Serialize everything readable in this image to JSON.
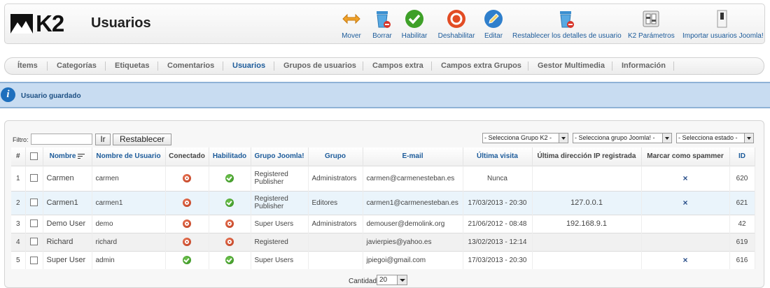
{
  "app": {
    "logo_text": "K2",
    "page_title": "Usuarios"
  },
  "toolbar": {
    "buttons": [
      {
        "label": "Mover",
        "icon": "move-arrows-icon"
      },
      {
        "label": "Borrar",
        "icon": "trash-icon"
      },
      {
        "label": "Habilitar",
        "icon": "check-circle-icon"
      },
      {
        "label": "Deshabilitar",
        "icon": "stop-circle-icon"
      },
      {
        "label": "Editar",
        "icon": "pencil-icon"
      },
      {
        "label": "Restablecer los detalles de usuario",
        "icon": "trash-reset-icon"
      },
      {
        "label": "K2 Parámetros",
        "icon": "settings-panel-icon"
      },
      {
        "label": "Importar usuarios Joomla!",
        "icon": "import-icon"
      }
    ]
  },
  "submenu": {
    "tabs": [
      {
        "label": "Ítems"
      },
      {
        "label": "Categorías"
      },
      {
        "label": "Etiquetas"
      },
      {
        "label": "Comentarios"
      },
      {
        "label": "Usuarios",
        "active": true
      },
      {
        "label": "Grupos de usuarios"
      },
      {
        "label": "Campos extra"
      },
      {
        "label": "Campos extra Grupos"
      },
      {
        "label": "Gestor Multimedia"
      },
      {
        "label": "Información"
      }
    ]
  },
  "message": {
    "text": "Usuario guardado",
    "icon": "info-icon"
  },
  "filter": {
    "label": "Filtro:",
    "value": "",
    "go_label": "Ir",
    "reset_label": "Restablecer",
    "selects": [
      {
        "value": "- Selecciona Grupo K2 -"
      },
      {
        "value": "- Selecciona grupo Joomla! -"
      },
      {
        "value": "- Selecciona estado -"
      }
    ]
  },
  "table": {
    "headers": {
      "num": "#",
      "nombre": "Nombre",
      "usuario": "Nombre de Usuario",
      "conectado": "Conectado",
      "habilitado": "Habilitado",
      "grupo_joomla": "Grupo Joomla!",
      "grupo": "Grupo",
      "email": "E-mail",
      "ultima_visita": "Última visita",
      "ip": "Última dirección IP registrada",
      "spammer": "Marcar como spammer",
      "id": "ID"
    },
    "rows": [
      {
        "num": "1",
        "nombre": "Carmen",
        "usuario": "carmen",
        "conectado": "off",
        "habilitado": "on",
        "grupo_joomla": "Registered Publisher",
        "grupo": "Administrators",
        "email": "carmen@carmenesteban.es",
        "ultima_visita": "Nunca",
        "ip": "",
        "spammer": "×",
        "id": "620"
      },
      {
        "num": "2",
        "nombre": "Carmen1",
        "usuario": "carmen1",
        "conectado": "off",
        "habilitado": "on",
        "grupo_joomla": "Registered Publisher",
        "grupo": "Editores",
        "email": "carmen1@carmenesteban.es",
        "ultima_visita": "17/03/2013 - 20:30",
        "ip": "127.0.0.1",
        "spammer": "×",
        "id": "621"
      },
      {
        "num": "3",
        "nombre": "Demo User",
        "usuario": "demo",
        "conectado": "off",
        "habilitado": "off",
        "grupo_joomla": "Super Users",
        "grupo": "Administrators",
        "email": "demouser@demolink.org",
        "ultima_visita": "21/06/2012 - 08:48",
        "ip": "192.168.9.1",
        "spammer": "",
        "id": "42"
      },
      {
        "num": "4",
        "nombre": "Richard",
        "usuario": "richard",
        "conectado": "off",
        "habilitado": "off",
        "grupo_joomla": "Registered",
        "grupo": "",
        "email": "javierpies@yahoo.es",
        "ultima_visita": "13/02/2013 - 12:14",
        "ip": "",
        "spammer": "",
        "id": "619"
      },
      {
        "num": "5",
        "nombre": "Super User",
        "usuario": "admin",
        "conectado": "on",
        "habilitado": "on",
        "grupo_joomla": "Super Users",
        "grupo": "",
        "email": "jpiegoi@gmail.com",
        "ultima_visita": "17/03/2013 - 20:30",
        "ip": "",
        "spammer": "×",
        "id": "616"
      }
    ]
  },
  "pagination": {
    "label": "Cantidad",
    "value": "20"
  },
  "colors": {
    "link": "#1c5b9a",
    "message_bg": "#c8dcf1",
    "enabled": "#2f8a1b",
    "disabled": "#b73618"
  }
}
